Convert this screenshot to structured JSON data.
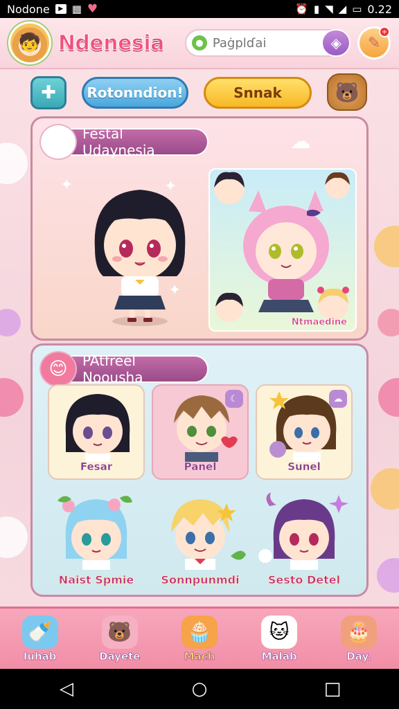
{
  "status_bar": {
    "carrier": "Nodone",
    "time": "0.22"
  },
  "header": {
    "title": "Ndenesia",
    "search_placeholder": "Paġplɗai"
  },
  "actions": {
    "blue_button": "Rotonndion!",
    "yellow_button": "Snnak"
  },
  "featured": {
    "header": "Festal Udaynesia",
    "caption": "Ntmaedine"
  },
  "section2": {
    "header": "PAtfreel Noousha",
    "cards": [
      {
        "label": "Fesar"
      },
      {
        "label": "Panel"
      },
      {
        "label": "Sunel"
      }
    ],
    "items": [
      {
        "label": "Naist Spmie"
      },
      {
        "label": "Sonnpunmdi"
      },
      {
        "label": "Sesto Detel"
      }
    ]
  },
  "bottom_nav": [
    {
      "label": "Iuhab",
      "icon": "bottle-icon"
    },
    {
      "label": "Dayete",
      "icon": "bear-icon"
    },
    {
      "label": "Mach",
      "icon": "muffin-icon"
    },
    {
      "label": "Malab",
      "icon": "cat-icon"
    },
    {
      "label": "Day.",
      "icon": "cake-icon"
    }
  ],
  "colors": {
    "accent_pink": "#f0517e",
    "panel_purple": "#9a4b89",
    "nav_pink": "#f28ea7"
  }
}
